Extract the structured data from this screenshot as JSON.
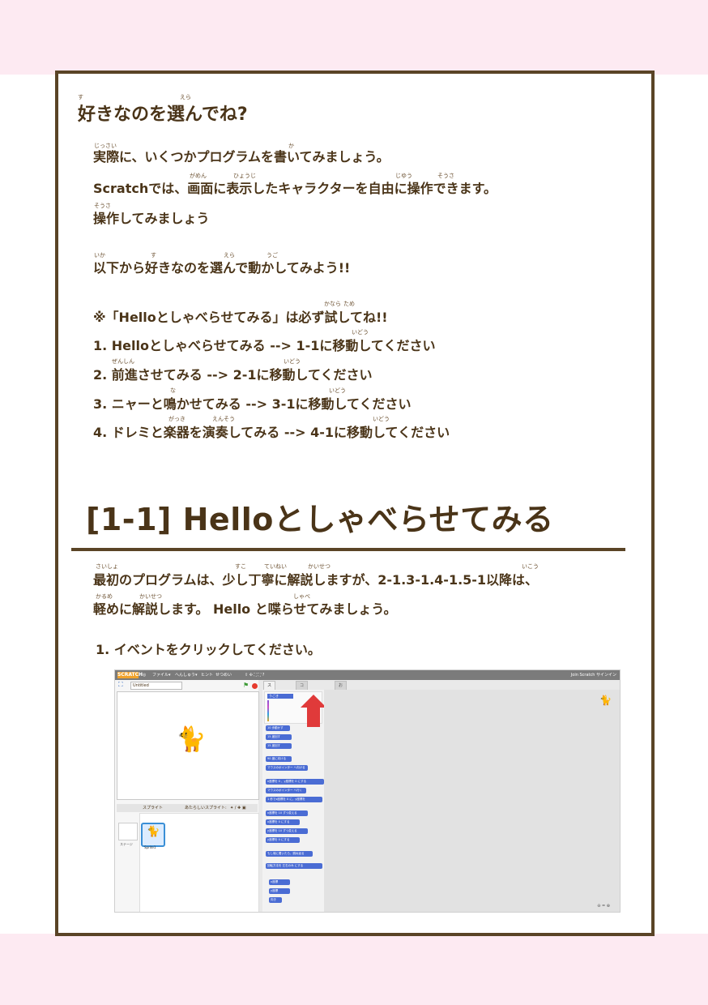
{
  "intro": {
    "heading": "好きなのを選んでね?",
    "heading_ruby": [
      {
        "text": "す"
      },
      {
        "text": "えら"
      }
    ],
    "lines": [
      {
        "text": "実際に、いくつかプログラムを書いてみましょう。"
      },
      {
        "text": "Scratchでは、画面に表示したキャラクターを自由に操作できます。"
      },
      {
        "text": "操作してみましょう"
      },
      {
        "text": "以下から好きなのを選んで動かしてみよう!!"
      },
      {
        "text": "※「Helloとしゃべらせてみる」は必ず試してね!!"
      },
      {
        "text": "1. Helloとしゃべらせてみる --> 1-1に移動してください"
      },
      {
        "text": "2. 前進させてみる --> 2-1に移動してください"
      },
      {
        "text": "3. ニャーと鳴かせてみる --> 3-1に移動してください"
      },
      {
        "text": "4. ドレミと楽器を演奏してみる --> 4-1に移動してください"
      }
    ],
    "ruby": [
      {
        "text": "じっさい"
      },
      {
        "text": "か"
      },
      {
        "text": "がめん"
      },
      {
        "text": "ひょうじ"
      },
      {
        "text": "じゆう"
      },
      {
        "text": "そうさ"
      },
      {
        "text": "そうさ"
      },
      {
        "text": "いか"
      },
      {
        "text": "す"
      },
      {
        "text": "えら"
      },
      {
        "text": "うご"
      },
      {
        "text": "かなら"
      },
      {
        "text": "ため"
      },
      {
        "text": "いどう"
      },
      {
        "text": "ぜんしん"
      },
      {
        "text": "いどう"
      },
      {
        "text": "な"
      },
      {
        "text": "いどう"
      },
      {
        "text": "がっき"
      },
      {
        "text": "えんそう"
      },
      {
        "text": "いどう"
      }
    ]
  },
  "section": {
    "title": "[1-1] Helloとしゃべらせてみる",
    "lines": [
      {
        "text": "最初のプログラムは、少し丁寧に解説しますが、2-1.3-1.4-1.5-1以降は、"
      },
      {
        "text": "軽めに解説します。 Hello と喋らせてみましょう。"
      },
      {
        "text": "1. イベントをクリックしてください。"
      }
    ],
    "ruby": [
      {
        "text": "さいしょ"
      },
      {
        "text": "すこ"
      },
      {
        "text": "ていねい"
      },
      {
        "text": "かいせつ"
      },
      {
        "text": "いこう"
      },
      {
        "text": "かるめ"
      },
      {
        "text": "かいせつ"
      },
      {
        "text": "しゃべ"
      }
    ]
  },
  "scratch": {
    "logo": "SCRATCH",
    "menu": [
      "ファイル▾",
      "へんしゅう▾",
      "ヒント",
      "せつめい"
    ],
    "signin": "Join Scratch  サインイン",
    "project_title": "Untitled",
    "tabs": [
      "スクリプト",
      "コスチューム",
      "おと"
    ],
    "category_selected": "うごき",
    "sprites_label": "スプライト",
    "new_sprite_label": "あたらしいスプライト:",
    "stage_label": "ステージ",
    "sprite_name": "Sprite1",
    "zoom": "⊖ = ⊕",
    "blocks": [
      "10 歩動かす",
      "15 度回す",
      "15 度回す",
      "90 度に向ける",
      "マウスのポインター へ向ける",
      "x座標を 0 、y座標を 0 にする",
      "マウスのポインター へ行く",
      "1 秒でx座標を 0 に、y座標を",
      "x座標を 10 ずつ変える",
      "x座標を 0 にする",
      "y座標を 10 ずつ変える",
      "y座標を 0 にする",
      "もし端に着いたら、跳ね返る",
      "回転方法を 左右のみ にする",
      "x座標",
      "y座標",
      "向き"
    ]
  }
}
